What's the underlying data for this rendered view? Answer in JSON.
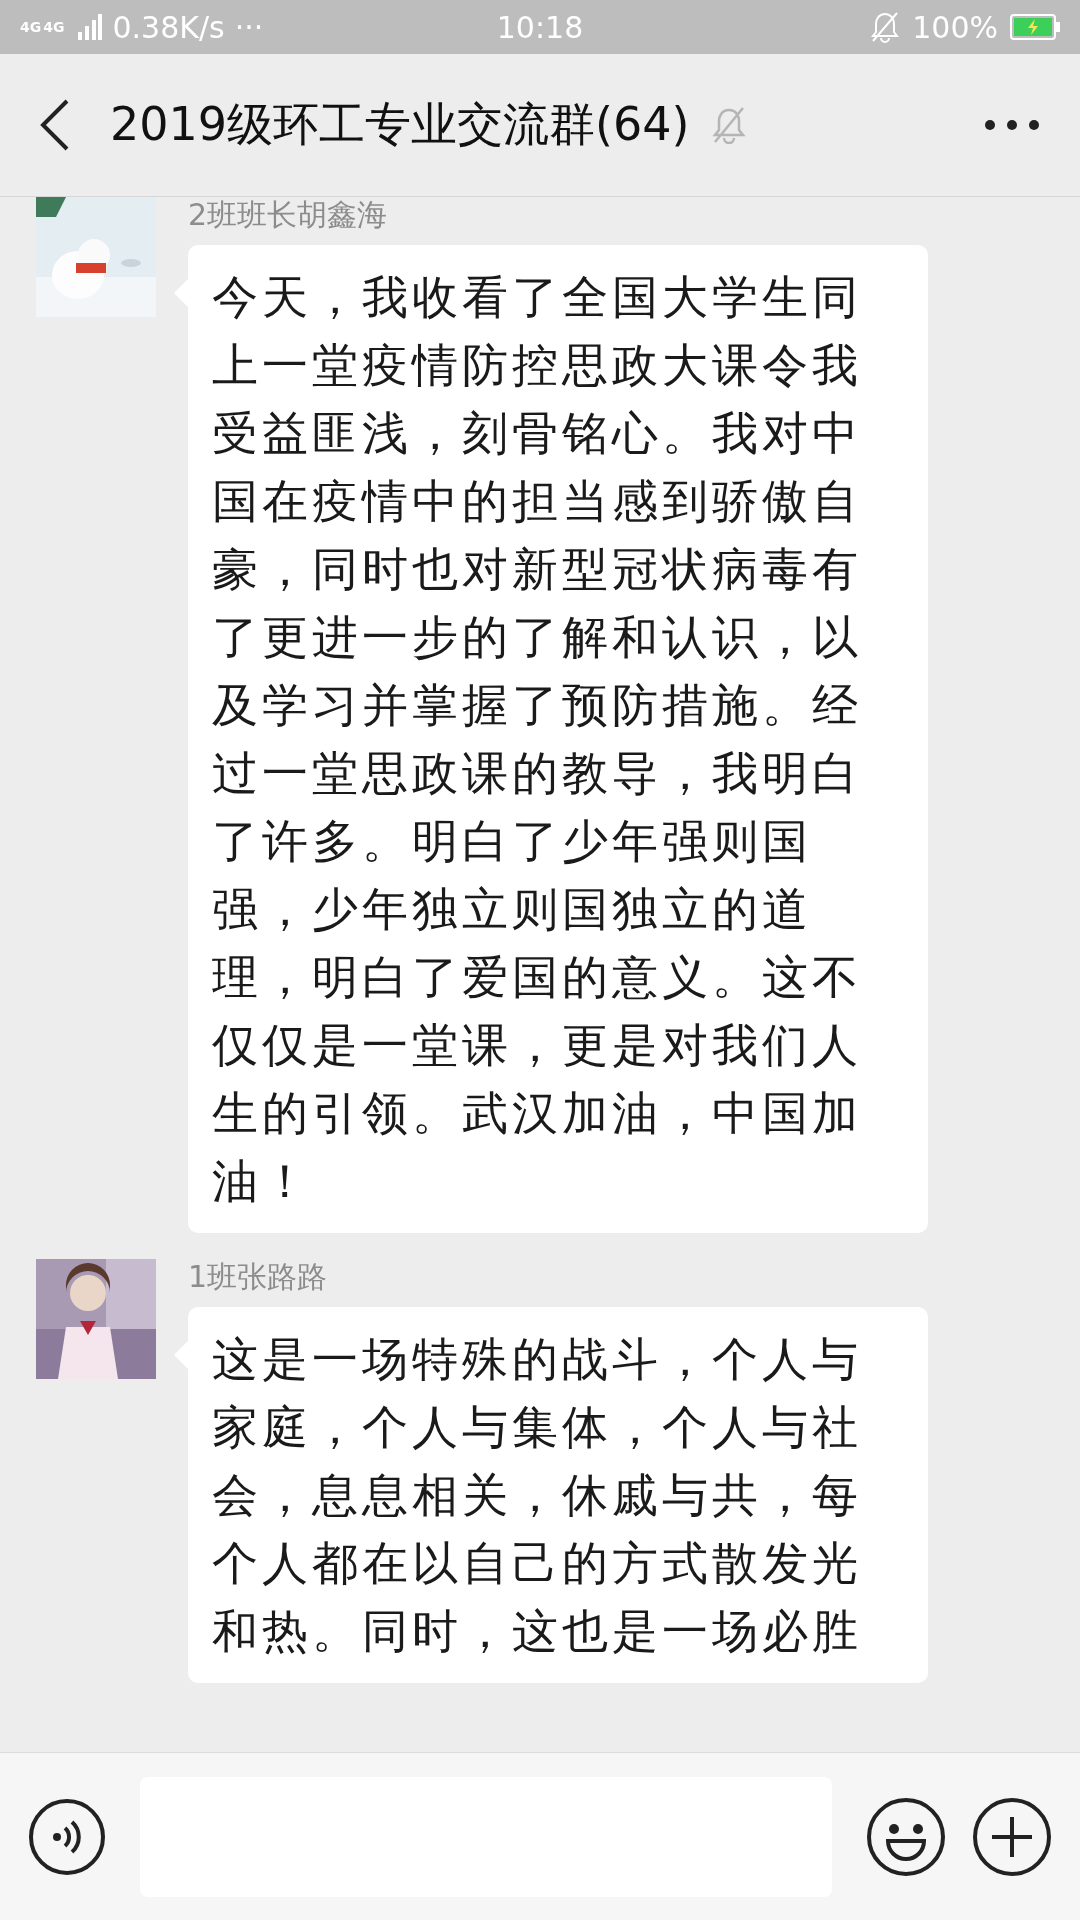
{
  "status_bar": {
    "network": "4G",
    "network_2": "4G",
    "speed": "0.38K/s",
    "more": "···",
    "time": "10:18",
    "battery": "100%"
  },
  "header": {
    "title": "2019级环工专业交流群(64)",
    "muted": true
  },
  "messages": [
    {
      "sender": "2班班长胡鑫海",
      "text": "今天，我收看了全国大学生同上一堂疫情防控思政大课令我受益匪浅，刻骨铭心。我对中国在疫情中的担当感到骄傲自豪，同时也对新型冠状病毒有了更进一步的了解和认识，以及学习并掌握了预防措施。经过一堂思政课的教导，我明白了许多。明白了少年强则国强，少年独立则国独立的道理，明白了爱国的意义。这不仅仅是一堂课，更是对我们人生的引领。武汉加油，中国加油！"
    },
    {
      "sender": "1班张路路",
      "text": "这是一场特殊的战斗，个人与家庭，个人与集体，个人与社会，息息相关，休戚与共，每个人都在以自己的方式散发光和热。同时，这也是一场必胜"
    }
  ]
}
